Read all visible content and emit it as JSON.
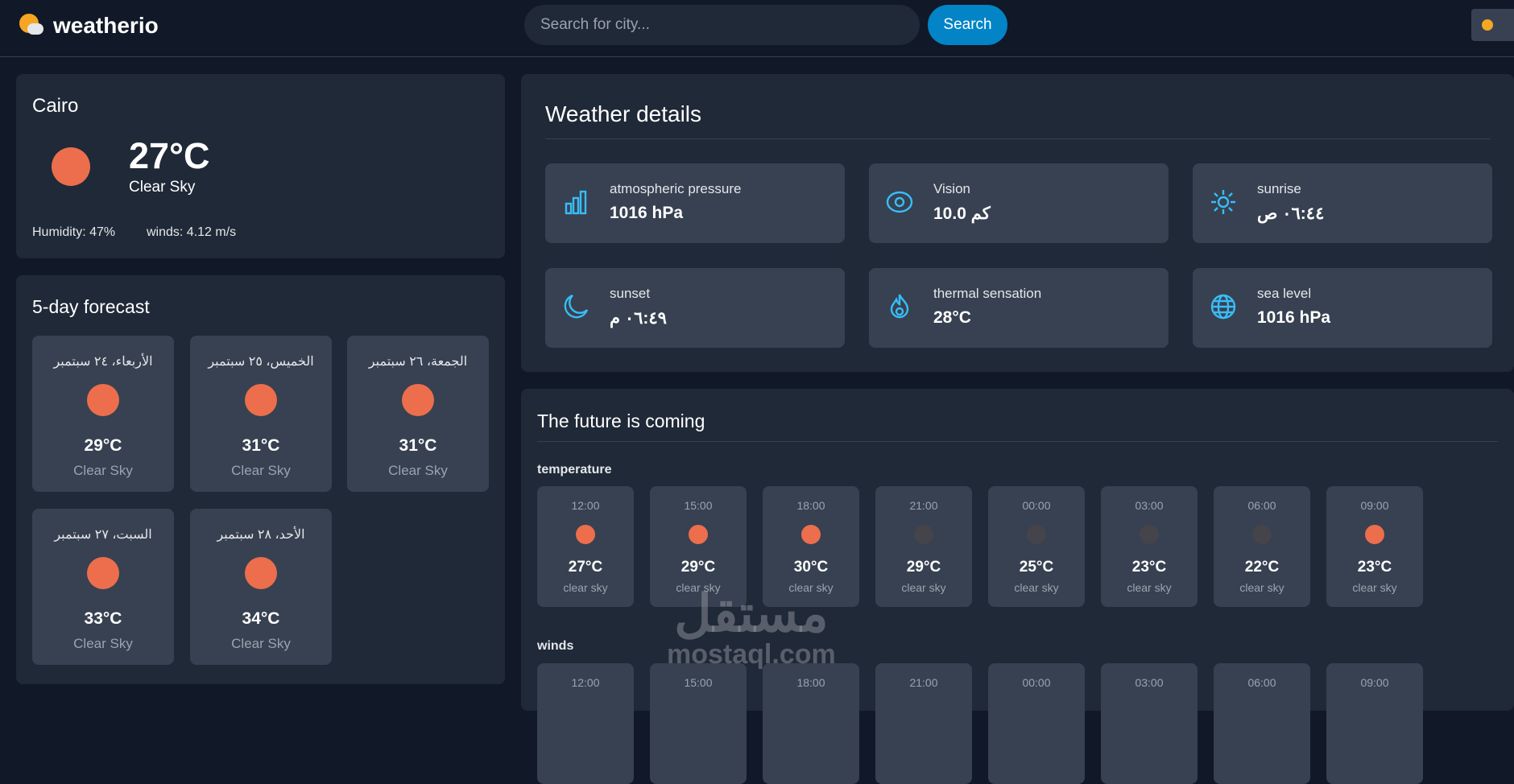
{
  "header": {
    "app_name": "weatherio",
    "search_placeholder": "Search for city...",
    "search_label": "Search"
  },
  "current": {
    "city": "Cairo",
    "temp": "27°C",
    "desc": "Clear Sky",
    "humidity": "Humidity: 47%",
    "winds": "winds: 4.12 m/s"
  },
  "forecast": {
    "title": "5-day forecast",
    "days": [
      {
        "date": "الأربعاء، ٢٤ سبتمبر",
        "temp": "29°C",
        "desc": "Clear Sky"
      },
      {
        "date": "الخميس، ٢٥ سبتمبر",
        "temp": "31°C",
        "desc": "Clear Sky"
      },
      {
        "date": "الجمعة، ٢٦ سبتمبر",
        "temp": "31°C",
        "desc": "Clear Sky"
      },
      {
        "date": "السبت، ٢٧ سبتمبر",
        "temp": "33°C",
        "desc": "Clear Sky"
      },
      {
        "date": "الأحد، ٢٨ سبتمبر",
        "temp": "34°C",
        "desc": "Clear Sky"
      }
    ]
  },
  "details": {
    "title": "Weather details",
    "items": [
      {
        "label": "atmospheric pressure",
        "value": "1016 hPa",
        "icon": "bar-chart-icon"
      },
      {
        "label": "Vision",
        "value": "10.0 كم",
        "icon": "eye-icon"
      },
      {
        "label": "sunrise",
        "value": "٠٦:٤٤ ص",
        "icon": "sun-icon"
      },
      {
        "label": "sunset",
        "value": "٠٦:٤٩ م",
        "icon": "moon-icon"
      },
      {
        "label": "thermal sensation",
        "value": "28°C",
        "icon": "flame-icon"
      },
      {
        "label": "sea level",
        "value": "1016 hPa",
        "icon": "globe-icon"
      }
    ]
  },
  "future": {
    "title": "The future is coming",
    "temperature_label": "temperature",
    "winds_label": "winds",
    "hours": [
      {
        "time": "12:00",
        "temp": "27°C",
        "desc": "clear sky",
        "night": false
      },
      {
        "time": "15:00",
        "temp": "29°C",
        "desc": "clear sky",
        "night": false
      },
      {
        "time": "18:00",
        "temp": "30°C",
        "desc": "clear sky",
        "night": false
      },
      {
        "time": "21:00",
        "temp": "29°C",
        "desc": "clear sky",
        "night": true
      },
      {
        "time": "00:00",
        "temp": "25°C",
        "desc": "clear sky",
        "night": true
      },
      {
        "time": "03:00",
        "temp": "23°C",
        "desc": "clear sky",
        "night": true
      },
      {
        "time": "06:00",
        "temp": "22°C",
        "desc": "clear sky",
        "night": true
      },
      {
        "time": "09:00",
        "temp": "23°C",
        "desc": "clear sky",
        "night": false
      }
    ]
  },
  "watermark": {
    "arabic": "مستقل",
    "latin": "mostaql.com"
  },
  "colors": {
    "accent": "#0284c7",
    "icon": "#38bdf8",
    "sun": "#ec6e4c"
  }
}
